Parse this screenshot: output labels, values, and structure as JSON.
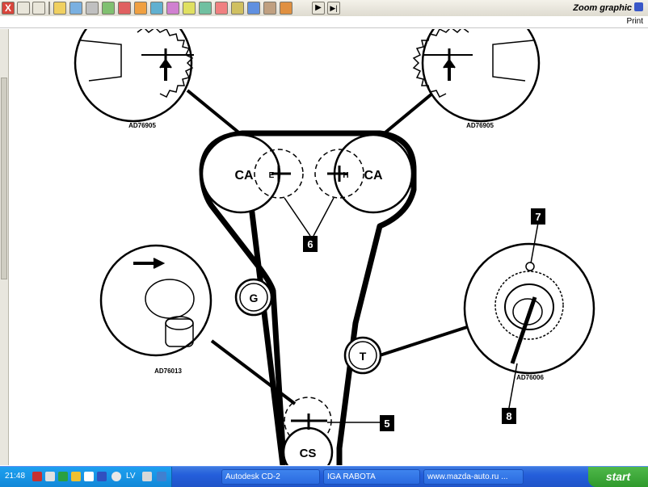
{
  "window": {
    "title": "Zoom graphic",
    "menu_print": "Print"
  },
  "toolbar": {
    "close_glyph": "X",
    "icons": [
      "minimize-icon",
      "restore-icon",
      "tool-1-icon",
      "tool-2-icon",
      "tool-3-icon",
      "tool-4-icon",
      "tool-5-icon",
      "tool-6-icon",
      "tool-7-icon",
      "tool-8-icon",
      "tool-9-icon",
      "tool-10-icon",
      "tool-11-icon",
      "tool-12-icon",
      "tool-13-icon",
      "tool-14-icon",
      "tool-15-icon"
    ],
    "play_glyph": "▶",
    "last_glyph": "▶|"
  },
  "diagram": {
    "detail_labels": {
      "top_left": "AD76905",
      "top_right": "AD76905",
      "left": "AD76013",
      "right": "AD76006"
    },
    "pulleys": {
      "cam_left": "CA",
      "cam_right": "CA",
      "crank": "CS",
      "idler": "G",
      "tensioner": "T"
    },
    "marks": {
      "left_cam": "E",
      "right_cam": "H"
    },
    "callouts": {
      "six": "6",
      "five": "5",
      "seven": "7",
      "eight": "8"
    }
  },
  "taskbar": {
    "clock": "21:48",
    "lang": "LV",
    "tasks": [
      "Autodesk CD-2",
      "IGA RABOTA",
      "www.mazda-auto.ru ..."
    ],
    "start_label": "start"
  }
}
